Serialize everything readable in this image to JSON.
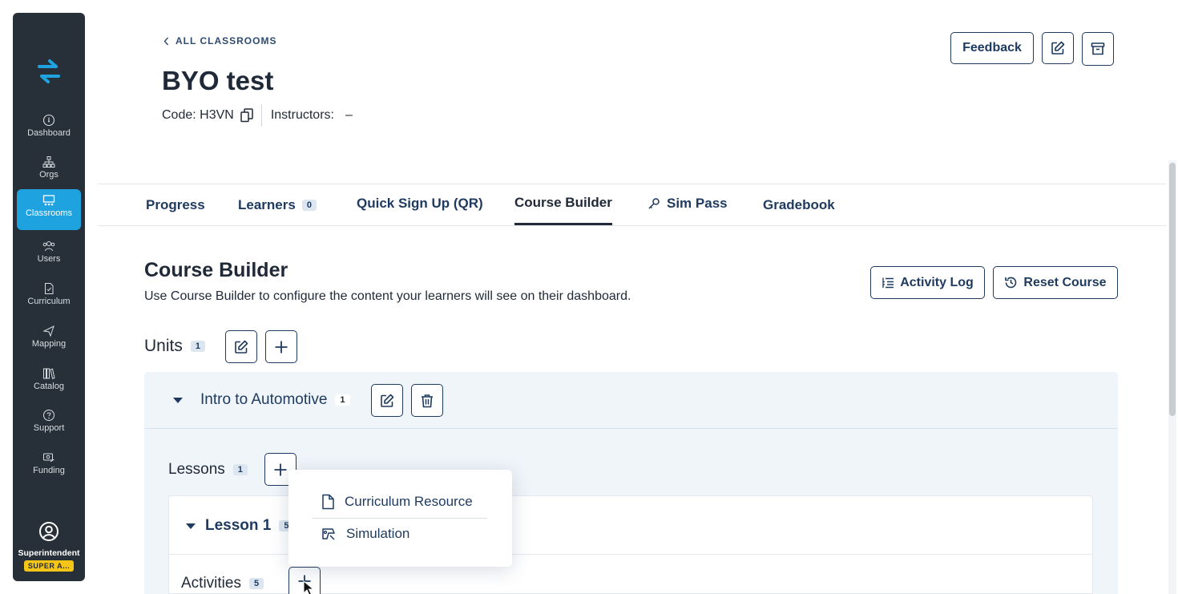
{
  "sidebar": {
    "items": [
      {
        "label": "Dashboard",
        "icon": "dashboard-icon"
      },
      {
        "label": "Orgs",
        "icon": "org-chart-icon"
      },
      {
        "label": "Classrooms",
        "icon": "classroom-icon",
        "active": true
      },
      {
        "label": "Users",
        "icon": "users-icon"
      },
      {
        "label": "Curriculum",
        "icon": "document-icon"
      },
      {
        "label": "Mapping",
        "icon": "map-pin-icon"
      },
      {
        "label": "Catalog",
        "icon": "books-icon"
      },
      {
        "label": "Support",
        "icon": "help-icon"
      },
      {
        "label": "Funding",
        "icon": "funding-icon"
      }
    ],
    "profile": {
      "role": "Superintendent",
      "badge": "SUPER A..."
    }
  },
  "header": {
    "back_label": "ALL CLASSROOMS",
    "title": "BYO test",
    "code_label": "Code: H3VN",
    "instructors_label": "Instructors:",
    "instructors_value": "–",
    "feedback_label": "Feedback"
  },
  "tabs": [
    {
      "label": "Progress"
    },
    {
      "label": "Learners",
      "count": "0"
    },
    {
      "label": "Quick Sign Up (QR)"
    },
    {
      "label": "Course Builder",
      "active": true
    },
    {
      "label": "Sim Pass"
    },
    {
      "label": "Gradebook"
    }
  ],
  "course_builder": {
    "title": "Course Builder",
    "description": "Use Course Builder to configure the content your learners will see on their dashboard.",
    "activity_log_label": "Activity Log",
    "reset_course_label": "Reset Course",
    "units_label": "Units",
    "units_count": "1",
    "unit": {
      "name": "Intro to Automotive",
      "count": "1"
    },
    "lessons_label": "Lessons",
    "lessons_count": "1",
    "lesson": {
      "name": "Lesson 1",
      "count": "5"
    },
    "activities_label": "Activities",
    "activities_count": "5"
  },
  "dropdown": {
    "items": [
      {
        "label": "Curriculum Resource",
        "icon": "file-icon"
      },
      {
        "label": "Simulation",
        "icon": "simulation-icon"
      }
    ]
  },
  "colors": {
    "sidebar_bg": "#273038",
    "accent": "#1ea3e0",
    "primary": "#1e3a5f",
    "badge": "#f5c518"
  }
}
